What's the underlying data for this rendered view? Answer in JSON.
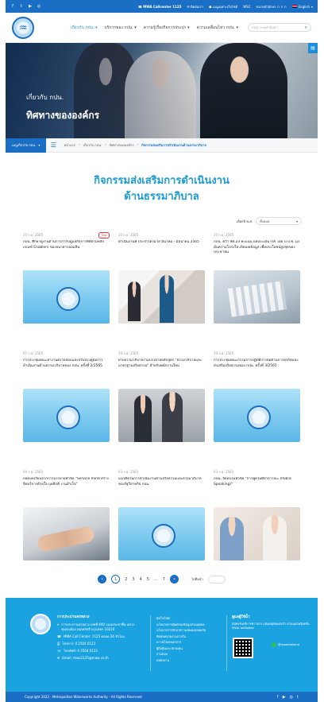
{
  "topbar": {
    "social": [
      "f",
      "t",
      "▶",
      "◎"
    ],
    "callcenter_label": "MWA Callcenter",
    "callcenter_number": "1125",
    "contact": "ติดต่อเรา",
    "pending": "เมนูเฉพาะเว็บไซต์",
    "wsc": "WSC",
    "font_size_label": "ขนาดตัวอักษร",
    "font_sizes": [
      "ก",
      "ก",
      "ก"
    ],
    "language": "English"
  },
  "nav": {
    "items": [
      "เกี่ยวกับ กปน.",
      "บริการของ กปน.",
      "ความรู้เรื่องกิจการประปา",
      "ความเคลื่อนไหว กปน."
    ],
    "search_placeholder": "กรุณาระบุคำค้นหา"
  },
  "hero": {
    "subtitle": "เกี่ยวกับ กปน.",
    "title": "ทิศทางขององค์กร"
  },
  "breadcrumb": {
    "about_button": "เมนูเกี่ยวกับ กปน.",
    "items": [
      "หน้าแรก",
      "เกี่ยวกับ กปน.",
      "ทิศทางขององค์กร"
    ],
    "current": "กิจกรรมส่งเสริมการดำเนินงานด้านธรรมาภิบาล"
  },
  "page": {
    "title_line1": "กิจกรรมส่งเสริมการดำเนินงาน",
    "title_line2": "ด้านธรรมาภิบาล",
    "filter_label": "เลือกปี พ.ศ.",
    "filter_value": "ทั้งหมด"
  },
  "cards": [
    {
      "date": "20 ก.ย. 2565",
      "badge": "ใหม่",
      "title": "กปน. ศึกษาดูงานด้านการกำกับดูแลกิจการที่ดีตามหลักเกณฑ์ Enablers ของธนาคารออมสิน"
    },
    {
      "date": "10 ก.ย. 2565",
      "badge": "",
      "title": "ดำเนินงานที่ ประจำไตรมาส มีนาคม - มิถุนายน 2565"
    },
    {
      "date": "20 ก.ย. 2565",
      "badge": "",
      "title": "กปน. คว้า 98.23 คะแนน ผลประเมิน ITA โดย ป.ป.ช. มุ่งมั่นความโปร่งใส เปิดเผยข้อมูล เพื่อประโยชน์สูงสุดของประชาชน"
    },
    {
      "date": "07 ก.ย. 2565",
      "badge": "",
      "title": "การประชุมคณะทำงานตรวจสอบและปรับปรุงคู่มือการดำเนินงานด้านธรรมาภิบาลของ กปน. ครั้งที่ 2/2565"
    },
    {
      "date": "10 ก.ย. 2565",
      "badge": "",
      "title": "ฝ่ายธรรมาภิบาลร่วมบรรยายหลักสูตร \"ธรรมาภิบาลและมาตรฐานจริยธรรม\" สำหรับพนักงานใหม่"
    },
    {
      "date": "10 ก.ย. 2565",
      "badge": "",
      "title": "การประชุมคณะกรรมการปฏิบัติการต่อต้านการทุจริตและส่งเสริมจริยธรรมของ กปน. ครั้งที่ 3/2565"
    },
    {
      "date": "04 ก.ย. 2565",
      "badge": "",
      "title": "ถอดบทเรียนจากการบรรยายหัวข้อ \"Service mind สร้างจิตบริการด้วยใจ บุคลิกดี งานสำเร็จ\""
    },
    {
      "date": "03 ก.ย. 2565",
      "badge": "",
      "title": "แนวคิดในการดำเนินงานด้านจริยธรรมและธรรมาภิบาลของรัฐวิสาหกิจ กปน."
    },
    {
      "date": "03 ก.ย. 2565",
      "badge": "",
      "title": "กปน. จัดอบรมหัวข้อ \"การพูดในที่สาธารณะ (Public Speaking)\""
    }
  ],
  "pager": {
    "pages": [
      "1",
      "2",
      "3",
      "4",
      "5",
      "...",
      "7"
    ],
    "goto_label": "ไปที่หน้า"
  },
  "footer": {
    "org": "การประปานครหลวง",
    "address": "การประปานครหลวง เลขที่ 400 ถนนประชาชื่น แขวงทุ่งสองห้อง เขตหลักสี่ กรุงเทพฯ 10210",
    "callcenter": "MWA Call Center: 1125 ตลอด 24 ชั่วโมง",
    "fax": "โทรสาร: 0 2504 0123",
    "phone": "โทรศัพท์: 0 2504 0123",
    "email": "Email: mwa1125@mwa.co.th",
    "links": [
      "ผังเว็บไซต์",
      "นโยบายการคุ้มครองข้อมูลส่วนบุคคล",
      "นโยบายการรักษาความมั่นคงปลอดภัย",
      "ติดต่อหน่วยงานภายใน",
      "ดาวน์โหลดเอกสาร",
      "ผู้ถือหุ้นและนักลงทุน",
      "ถามตอบ",
      "สมัครงาน"
    ],
    "contact_title": "ดูแลผู้ใช้น้ำ",
    "contact_text": "สมัครรับบริการข่าวสาร แจ้งเหตุท่อแตกรั่ว ผ่านแอปพลิเคชัน MWA onMobile",
    "line_label": "@mwathailand",
    "copyright": "Copyright 2022 - Metropolitan Waterworks Authority - All Rights Reserved.",
    "social": [
      "f",
      "▶",
      "◎",
      "t"
    ]
  },
  "colors": {
    "primary": "#1a6fc4",
    "accent": "#1a9ad6",
    "footer": "#1aa3e0"
  }
}
